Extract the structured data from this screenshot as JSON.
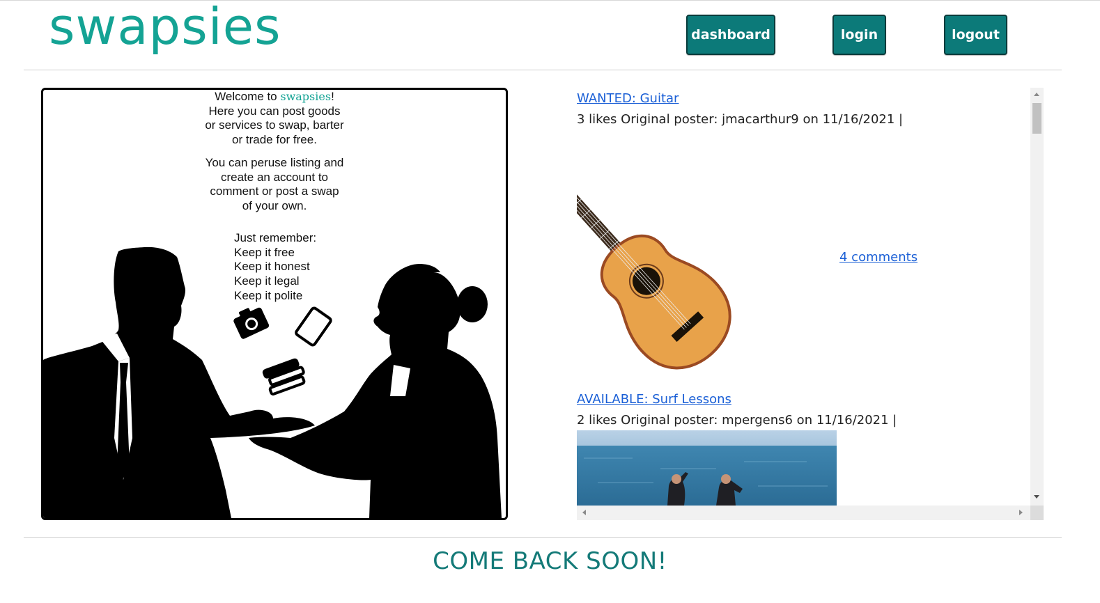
{
  "header": {
    "brand": "swapsies",
    "nav": [
      {
        "label": "dashboard"
      },
      {
        "label": "login"
      },
      {
        "label": "logout"
      }
    ]
  },
  "intro": {
    "welcome_prefix": "Welcome to ",
    "welcome_brand": "swapsies",
    "welcome_suffix": "!",
    "lines1": [
      "Here you can post goods",
      "or services to swap, barter",
      "or trade for free."
    ],
    "lines2": [
      "You can peruse listing and",
      "create an account to",
      "comment or post a swap",
      "of your own."
    ],
    "rules_heading": "Just remember:",
    "rules": [
      "Keep it free",
      "Keep it honest",
      "Keep it legal",
      "Keep it polite"
    ],
    "icons": [
      "camera-icon",
      "tablet-icon",
      "books-icon"
    ]
  },
  "posts": [
    {
      "title": "WANTED: Guitar",
      "meta": "3 likes Original poster: jmacarthur9 on 11/16/2021 |",
      "comments": "4 comments",
      "image": "guitar"
    },
    {
      "title": "AVAILABLE: Surf Lessons",
      "meta": "2 likes Original poster: mpergens6 on 11/16/2021 |",
      "image": "surfers-in-ocean"
    }
  ],
  "footer": {
    "message": "COME BACK SOON!"
  },
  "colors": {
    "brand": "#14a394",
    "button": "#0c7a79",
    "link": "#1a5fd6",
    "footer": "#147a78"
  }
}
